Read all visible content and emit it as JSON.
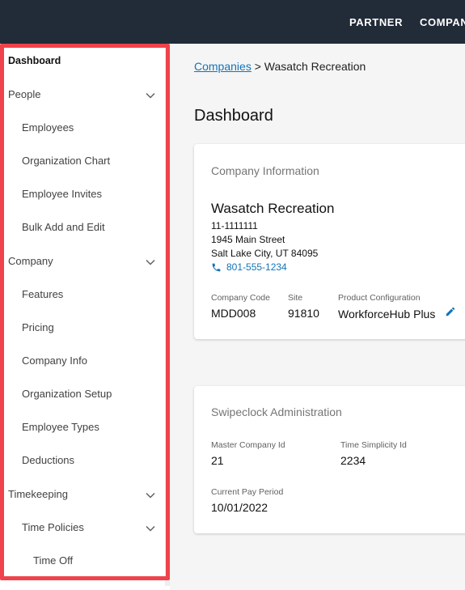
{
  "topbar": {
    "partner": "PARTNER",
    "company": "COMPANY"
  },
  "sidebar": {
    "dashboard": "Dashboard",
    "people": "People",
    "employees": "Employees",
    "org_chart": "Organization Chart",
    "employee_invites": "Employee Invites",
    "bulk_add": "Bulk Add and Edit",
    "company": "Company",
    "features": "Features",
    "pricing": "Pricing",
    "company_info": "Company Info",
    "org_setup": "Organization Setup",
    "employee_types": "Employee Types",
    "deductions": "Deductions",
    "timekeeping": "Timekeeping",
    "time_policies": "Time Policies",
    "time_off": "Time Off"
  },
  "breadcrumb": {
    "link": "Companies",
    "separator": " > ",
    "current": "Wasatch Recreation"
  },
  "page_title": "Dashboard",
  "company_info": {
    "title": "Company Information",
    "name": "Wasatch Recreation",
    "ein": "11-1111111",
    "street": "1945 Main Street",
    "city": "Salt Lake City, UT 84095",
    "phone": "801-555-1234",
    "code_label": "Company Code",
    "code_value": "MDD008",
    "site_label": "Site",
    "site_value": "91810",
    "product_label": "Product Configuration",
    "product_value": "WorkforceHub Plus"
  },
  "swipeclock": {
    "title": "Swipeclock Administration",
    "master_label": "Master Company Id",
    "master_value": "21",
    "ts_label": "Time Simplicity Id",
    "ts_value": "2234",
    "period_label": "Current Pay Period",
    "period_value": "10/01/2022"
  },
  "colors": {
    "topbar": "#222b38",
    "accent": "#1273b7",
    "highlight_border": "#f0424a"
  }
}
